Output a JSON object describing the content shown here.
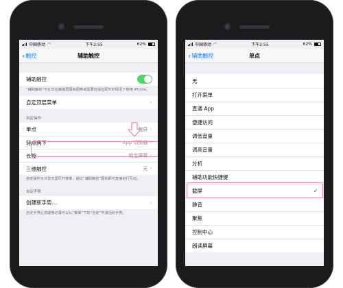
{
  "status": {
    "carrier": "中国移动",
    "time": "下午2:55",
    "battery": "62%"
  },
  "left": {
    "back_label": "触控",
    "title": "辅助触控",
    "assistive_touch_label": "辅助触控",
    "assistive_touch_on": true,
    "assistive_touch_desc": "“辅助触控”可让您在触摸屏幕有困难或需要自适应配件的情况下使用 iPhone。",
    "customize_menu_label": "自定顶层菜单",
    "custom_actions_header": "自定操作",
    "actions": [
      {
        "label": "单点",
        "value": "截屏"
      },
      {
        "label": "轻点两下",
        "value": "App 切换器"
      },
      {
        "label": "长按",
        "value": "锁定屏幕"
      },
      {
        "label": "三维触控",
        "value": "无"
      }
    ],
    "actions_footer": "自定操作允许您无需打开菜单，通过“辅助触控”图标即可直接进行互动。",
    "custom_gestures_header": "自定手势",
    "create_gesture_label": "创建新手势...",
    "gestures_footer": "自定手势让您能够记录可以从“菜单”下的“自定”中激活的手势。"
  },
  "right": {
    "back_label": "辅助触控",
    "title": "单点",
    "options": [
      "无",
      "打开菜单",
      "直通 App",
      "便捷访问",
      "调低音量",
      "调高音量",
      "分析",
      "辅助功能快捷键",
      "截屏",
      "静音",
      "聚焦",
      "控制中心",
      "朗读屏幕"
    ],
    "selected": "截屏"
  },
  "colors": {
    "accent": "#1f7aeb",
    "toggle_on": "#4cd964",
    "highlight": "#e98aa6"
  },
  "icons": [
    "signal-icon",
    "wifi-icon",
    "battery-icon",
    "chevron-left-icon",
    "chevron-right-icon",
    "checkmark-icon",
    "down-arrow-icon"
  ]
}
